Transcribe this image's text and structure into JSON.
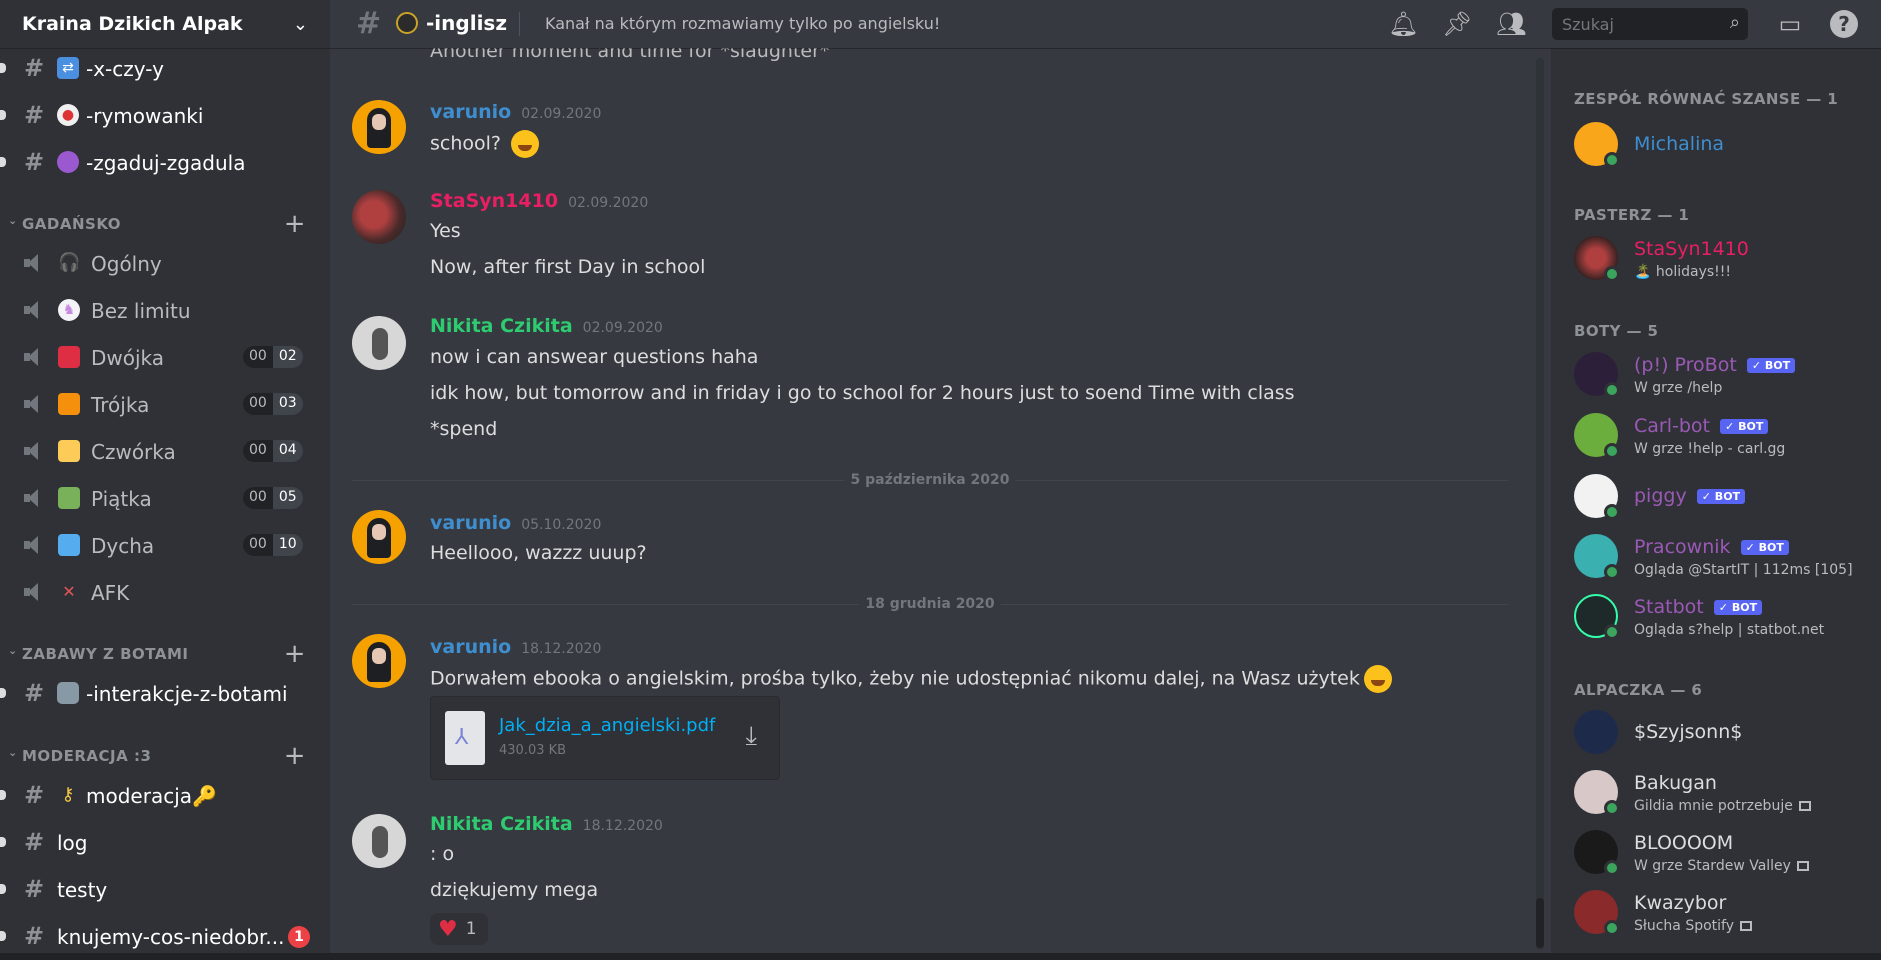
{
  "server": {
    "name": "Kraina Dzikich Alpak"
  },
  "colors": {
    "blurple": "#5865f2",
    "green": "#3ba55d",
    "red": "#ed4245",
    "link": "#00aff4"
  },
  "sidebar": {
    "top_channels": [
      {
        "label": "-x-czy-y",
        "icon": "shuffle-icon"
      },
      {
        "label": "-rymowanki",
        "icon": "clown-icon"
      },
      {
        "label": "-zgaduj-zgadula",
        "icon": "crystal-ball-icon"
      }
    ],
    "cat_gadansko": "GADAŃSKO",
    "voice": [
      {
        "label": "Ogólny",
        "icon": "headphones-icon"
      },
      {
        "label": "Bez limitu",
        "icon": "unicorn-icon"
      },
      {
        "label": "Dwójka",
        "icon": "red-square-icon",
        "a": "00",
        "b": "02"
      },
      {
        "label": "Trójka",
        "icon": "orange-square-icon",
        "a": "00",
        "b": "03"
      },
      {
        "label": "Czwórka",
        "icon": "yellow-square-icon",
        "a": "00",
        "b": "04"
      },
      {
        "label": "Piątka",
        "icon": "green-square-icon",
        "a": "00",
        "b": "05"
      },
      {
        "label": "Dycha",
        "icon": "blue-square-icon",
        "a": "00",
        "b": "10"
      },
      {
        "label": "AFK",
        "icon": "muted-speaker-icon"
      }
    ],
    "cat_zabawy": "ZABAWY Z BOTAMI",
    "zabawy_channel": "-interakcje-z-botami",
    "cat_moderacja": "MODERACJA :3",
    "mod_channels": [
      {
        "label": "moderacja🔑"
      },
      {
        "label": "log"
      },
      {
        "label": "testy"
      },
      {
        "label": "knujemy-cos-niedobr...",
        "mentions": "1"
      }
    ]
  },
  "topbar": {
    "channel": "-inglisz",
    "topic": "Kanał na którym rozmawiamy tylko po angielsku!",
    "search_placeholder": "Szukaj"
  },
  "chat": {
    "partial_line": "Another moment and time for *slaughter*",
    "messages": [
      {
        "user": "varunio",
        "date": "02.09.2020",
        "lines": [
          "school?"
        ]
      },
      {
        "user": "StaSyn1410",
        "date": "02.09.2020",
        "lines": [
          "Yes",
          "Now, after first Day in school"
        ]
      },
      {
        "user": "Nikita Czikita",
        "date": "02.09.2020",
        "lines": [
          "now i can answear questions haha",
          "idk how, but tomorrow and in friday i go to school for 2 hours just to soend Time with class",
          "*spend"
        ]
      },
      {
        "user": "varunio",
        "date": "05.10.2020",
        "lines": [
          "Heellooo, wazzz uuup?"
        ]
      },
      {
        "user": "varunio",
        "date": "18.12.2020",
        "lines": [
          "Dorwałem ebooka o angielskim, prośba tylko, żeby nie udostępniać nikomu dalej, na Wasz użytek"
        ]
      },
      {
        "user": "Nikita Czikita",
        "date": "18.12.2020",
        "lines": [
          ": o",
          "dziękujemy mega"
        ]
      }
    ],
    "divider1": "5 października 2020",
    "divider2": "18 grudnia 2020",
    "attachment": {
      "name": "Jak_dzia_a_angielski.pdf",
      "size": "430.03 KB"
    },
    "reaction": {
      "emoji": "heart-icon",
      "count": "1"
    }
  },
  "members": {
    "cat1": "ZESPÓŁ RÓWNAĆ SZANSE — 1",
    "cat2": "PASTERZ — 1",
    "cat3": "BOTY — 5",
    "cat4": "ALPACZKA — 6",
    "list": [
      {
        "name": "Michalina",
        "activity": ""
      },
      {
        "name": "StaSyn1410",
        "activity": "🏝️ holidays!!!"
      },
      {
        "name": "(p!) ProBot",
        "activity": "W grze /help",
        "bot": "✓ BOT"
      },
      {
        "name": "Carl-bot",
        "activity": "W grze !help - carl.gg",
        "bot": "✓ BOT"
      },
      {
        "name": "piggy",
        "activity": "",
        "bot": "✓ BOT"
      },
      {
        "name": "Pracownik",
        "activity": "Ogląda @StartIT | 112ms [105]",
        "bot": "✓ BOT"
      },
      {
        "name": "Statbot",
        "activity": "Ogląda s?help | statbot.net",
        "bot": "✓ BOT"
      },
      {
        "name": "$Szyjsonn$",
        "activity": ""
      },
      {
        "name": "Bakugan",
        "activity": "Gildia mnie potrzebuje"
      },
      {
        "name": "BLOOOOM",
        "activity": "W grze Stardew Valley"
      },
      {
        "name": "Kwazybor",
        "activity": "Słucha Spotify"
      }
    ]
  }
}
